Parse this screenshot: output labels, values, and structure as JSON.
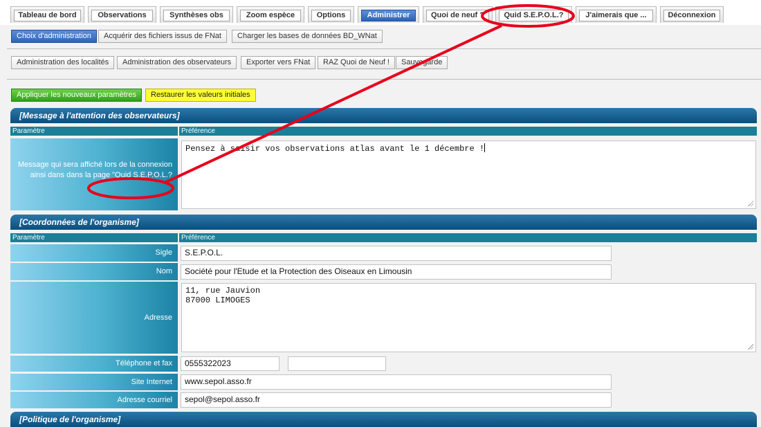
{
  "nav_tabs": [
    {
      "label": "Tableau de bord"
    },
    {
      "label": "Observations"
    },
    {
      "label": "Synthèses obs"
    },
    {
      "label": "Zoom espèce"
    },
    {
      "label": "Options"
    },
    {
      "label": "Administrer",
      "active": true
    },
    {
      "label": "Quoi de neuf ?"
    },
    {
      "label": "Quid S.E.P.O.L.?"
    },
    {
      "label": "J'aimerais que ..."
    },
    {
      "label": "Déconnexion"
    }
  ],
  "admin_row1": [
    {
      "label": "Choix d'administration",
      "active": true
    },
    {
      "label": "Acquérir des fichiers issus de FNat"
    },
    {
      "label": "Charger les bases de données BD_WNat"
    }
  ],
  "admin_row2": [
    {
      "label": "Administration des localités"
    },
    {
      "label": "Administration des observateurs"
    },
    {
      "label": "Exporter vers FNat"
    },
    {
      "label": "RAZ Quoi de Neuf !"
    },
    {
      "label": "Sauvegarde"
    }
  ],
  "actions": {
    "apply_label": "Appliquer les nouveaux paramètres",
    "restore_label": "Restaurer les valeurs initiales"
  },
  "columns": {
    "param": "Paramètre",
    "pref": "Préférence"
  },
  "section_message": {
    "title": "[Message à l'attention des observateurs]",
    "param_label": "Message qui sera affiché lors de la connexion ainsi dans dans la page \"Quid S.E.P.O.L.?",
    "value": "Pensez à saisir vos observations atlas avant le 1 décembre !"
  },
  "section_org": {
    "title": "[Coordonnées de l'organisme]",
    "sigle_label": "Sigle",
    "sigle_value": "S.E.P.O.L.",
    "nom_label": "Nom",
    "nom_value": "Société pour l'Etude et la Protection des Oiseaux en Limousin",
    "adresse_label": "Adresse",
    "adresse_value": "11, rue Jauvion\n87000 LIMOGES",
    "tel_label": "Téléphone et fax",
    "tel_value": "0555322023",
    "fax_value": "",
    "site_label": "Site Internet",
    "site_value": "www.sepol.asso.fr",
    "email_label": "Adresse courriel",
    "email_value": "sepol@sepol.asso.fr"
  },
  "section_politique": {
    "title": "[Politique de l'organisme]"
  },
  "annotation": {
    "color": "#e8001c"
  }
}
